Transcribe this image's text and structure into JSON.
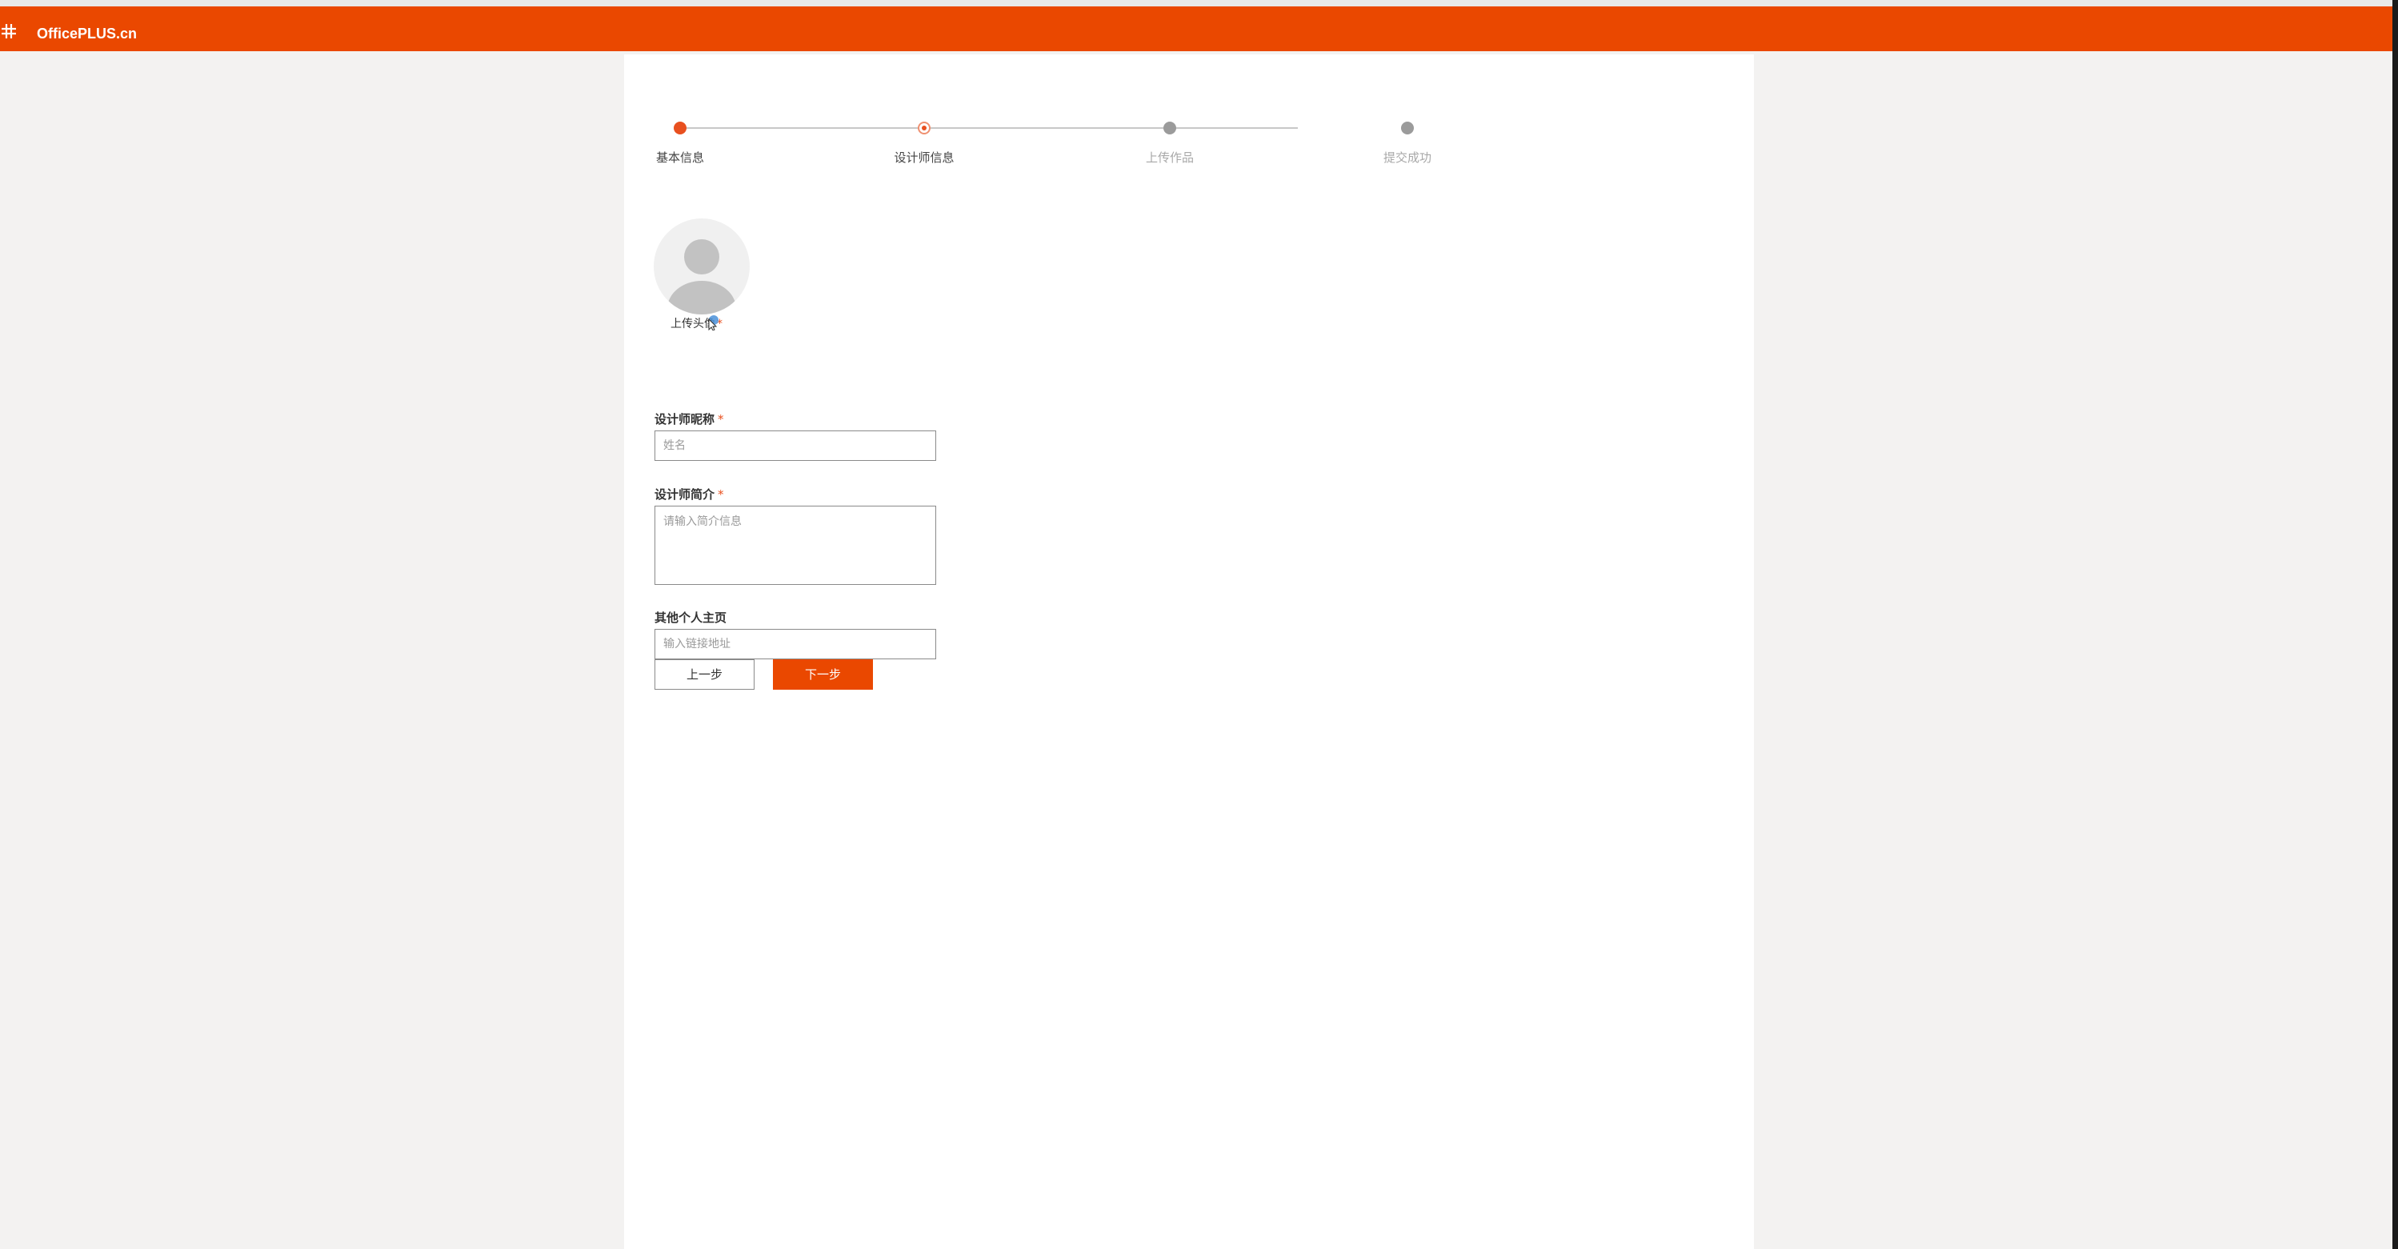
{
  "header": {
    "logo_text": "OfficePLUS.cn",
    "brand_color": "#ea4800"
  },
  "stepper": {
    "steps": [
      {
        "label": "基本信息",
        "state": "done"
      },
      {
        "label": "设计师信息",
        "state": "current"
      },
      {
        "label": "上传作品",
        "state": "pending"
      },
      {
        "label": "提交成功",
        "state": "pending"
      }
    ]
  },
  "avatar": {
    "upload_label": "上传头像",
    "required_mark": "*"
  },
  "form": {
    "nickname": {
      "label": "设计师昵称",
      "required_mark": "*",
      "placeholder": "姓名",
      "value": ""
    },
    "bio": {
      "label": "设计师简介",
      "required_mark": "*",
      "placeholder": "请输入简介信息",
      "value": ""
    },
    "homepage": {
      "label": "其他个人主页",
      "placeholder": "输入链接地址",
      "value": ""
    }
  },
  "buttons": {
    "prev": "上一步",
    "next": "下一步"
  }
}
